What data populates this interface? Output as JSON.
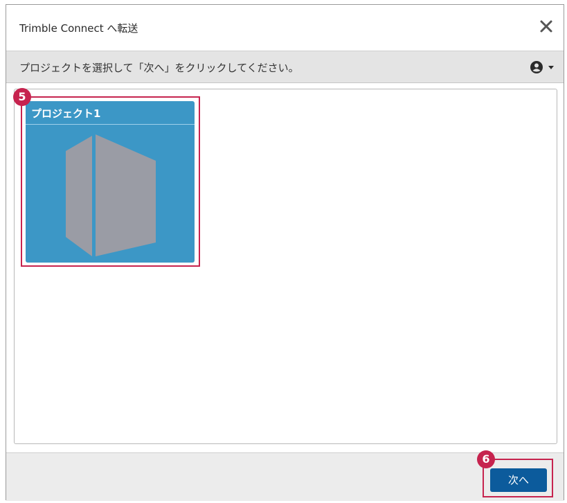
{
  "dialog": {
    "title": "Trimble Connect へ転送",
    "close_icon": "close-icon"
  },
  "instruction": {
    "text": "プロジェクトを選択して「次へ」をクリックしてください。",
    "user_menu_icon": "user-icon"
  },
  "projects": [
    {
      "name": "プロジェクト1",
      "icon": "building-icon",
      "color": "#3c97c6"
    }
  ],
  "footer": {
    "next_label": "次へ"
  },
  "annotations": {
    "badge_1": "5",
    "badge_2": "6",
    "color": "#c6234e"
  }
}
